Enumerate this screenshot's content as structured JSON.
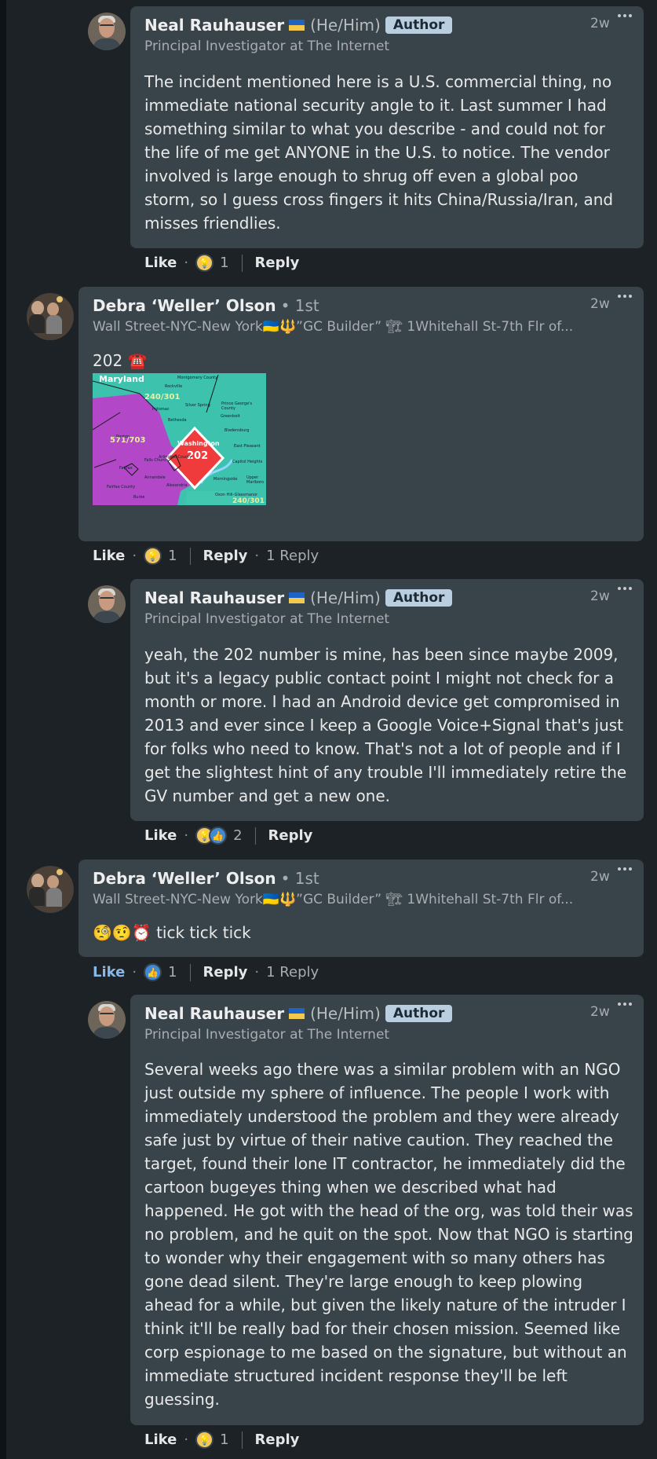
{
  "comments": [
    {
      "author": "Neal Rauhauser",
      "pronouns": "(He/Him)",
      "badge": "Author",
      "subtitle": "Principal Investigator at The Internet",
      "time": "2w",
      "text": "The incident mentioned here is a U.S. commercial thing, no immediate national security angle to it. Last summer I had something similar to what you describe - and could not for the life of me get ANYONE in the U.S. to notice. The vendor involved is large enough to shrug off even a global poo storm, so I guess cross fingers it hits China/Russia/Iran, and misses friendlies.",
      "like_label": "Like",
      "reaction_count": "1",
      "reply_label": "Reply"
    },
    {
      "author": "Debra ‘Weller’ Olson",
      "degree": "• 1st",
      "subtitle": "Wall Street-NYC-New York🇺🇦🔱”GC Builder” 🏗 1Whitehall St-7th Flr of...",
      "time": "2w",
      "text": "202 ☎️",
      "like_label": "Like",
      "reaction_count": "1",
      "reply_label": "Reply",
      "replies_label": "1 Reply",
      "map": {
        "state": "Maryland",
        "county_top": "Montgomery County",
        "code_a": "240/301",
        "code_b": "571/703",
        "center": "Washington",
        "center_code": "202",
        "code_bottom": "240/301",
        "places": [
          "Rockville",
          "Silver Spring",
          "Potomac",
          "Bethesda",
          "Prince George's County",
          "Greenbelt",
          "Bladensburg",
          "Reston",
          "Falls Church",
          "Arlington County",
          "Annandale",
          "Alexandria",
          "Fairfax",
          "Fairfax County",
          "Burke",
          "East Pleasant",
          "Capitol Heights",
          "Morningside",
          "Upper Marlboro",
          "Oxon Hill-Glassmanor"
        ]
      }
    },
    {
      "author": "Neal Rauhauser",
      "pronouns": "(He/Him)",
      "badge": "Author",
      "subtitle": "Principal Investigator at The Internet",
      "time": "2w",
      "text": "yeah, the 202 number is mine, has been since maybe 2009, but it's a legacy public contact point I might not check for a month or more. I had an Android device get compromised in 2013 and ever since I keep a Google Voice+Signal that's just for folks who need to know. That's not a lot of people and if I get the slightest hint of any trouble I'll immediately retire the GV number and get a new one.",
      "like_label": "Like",
      "reaction_count": "2",
      "reply_label": "Reply"
    },
    {
      "author": "Debra ‘Weller’ Olson",
      "degree": "• 1st",
      "subtitle": "Wall Street-NYC-New York🇺🇦🔱”GC Builder” 🏗 1Whitehall St-7th Flr of...",
      "time": "2w",
      "text": "🧐🤨⏰ tick tick tick",
      "like_label": "Like",
      "reaction_count": "1",
      "reply_label": "Reply",
      "replies_label": "1 Reply"
    },
    {
      "author": "Neal Rauhauser",
      "pronouns": "(He/Him)",
      "badge": "Author",
      "subtitle": "Principal Investigator at The Internet",
      "time": "2w",
      "text": "Several weeks ago there was a similar problem with an NGO just outside my sphere of influence. The people I work with immediately understood the problem and they were already safe just by virtue of their native caution. They reached the target, found their lone IT contractor, he immediately did the cartoon bugeyes thing when we described what had happened. He got with the head of the org, was told their was no problem, and he quit on the spot. Now that NGO is starting to wonder why their engagement with so many others has gone dead silent. They're large enough to keep plowing ahead for a while, but given the likely nature of the intruder I think it'll be really bad for their chosen mission. Seemed like corp espionage to me based on the signature, but without an immediate structured incident response they'll be left guessing.",
      "like_label": "Like",
      "reaction_count": "1",
      "reply_label": "Reply"
    }
  ]
}
